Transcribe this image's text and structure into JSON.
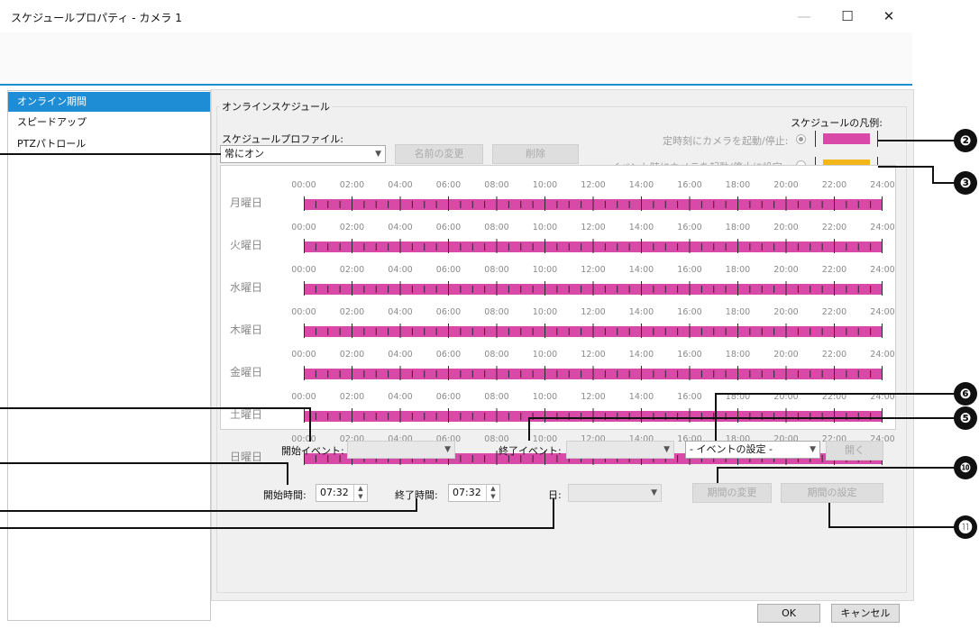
{
  "window": {
    "title": "スケジュールプロパティ - カメラ 1",
    "minimize": "—",
    "maximize": "☐",
    "close": "✕"
  },
  "sidebar": {
    "items": [
      {
        "label": "オンライン期間",
        "active": true
      },
      {
        "label": "スピードアップ",
        "active": false
      },
      {
        "label": "PTZパトロール",
        "active": false
      }
    ]
  },
  "main": {
    "group_title": "オンラインスケジュール",
    "profile_label": "スケジュールプロファイル:",
    "profile_value": "常にオン",
    "rename_button": "名前の変更",
    "delete_button": "削除",
    "legend_title": "スケジュールの凡例:",
    "legend_timed": "定時刻にカメラを起動/停止:",
    "legend_event": "イベント時にカメラを起動/停止に設定:",
    "colors": {
      "timed": "#d94aa8",
      "event": "#f2b51a",
      "accent": "#1f8dd6"
    }
  },
  "schedule": {
    "days": [
      "月曜日",
      "火曜日",
      "水曜日",
      "木曜日",
      "金曜日",
      "土曜日",
      "日曜日"
    ],
    "hours": [
      "00:00",
      "02:00",
      "04:00",
      "06:00",
      "08:00",
      "10:00",
      "12:00",
      "14:00",
      "16:00",
      "18:00",
      "20:00",
      "22:00",
      "24:00"
    ]
  },
  "controls": {
    "start_event_label": "開始イベント:",
    "end_event_label": "終了イベント:",
    "event_setting_value": "- イベントの設定 -",
    "open_button": "開く",
    "start_time_label": "開始時間:",
    "start_time_value": "07:32",
    "end_time_label": "終了時間:",
    "end_time_value": "07:32",
    "day_label": "日:",
    "change_period_button": "期間の変更",
    "set_period_button": "期間の設定"
  },
  "footer": {
    "ok_button": "OK",
    "cancel_button": "キャンセル"
  },
  "callouts": [
    "❷",
    "❸",
    "❺",
    "❻",
    "❿",
    "⓫"
  ]
}
